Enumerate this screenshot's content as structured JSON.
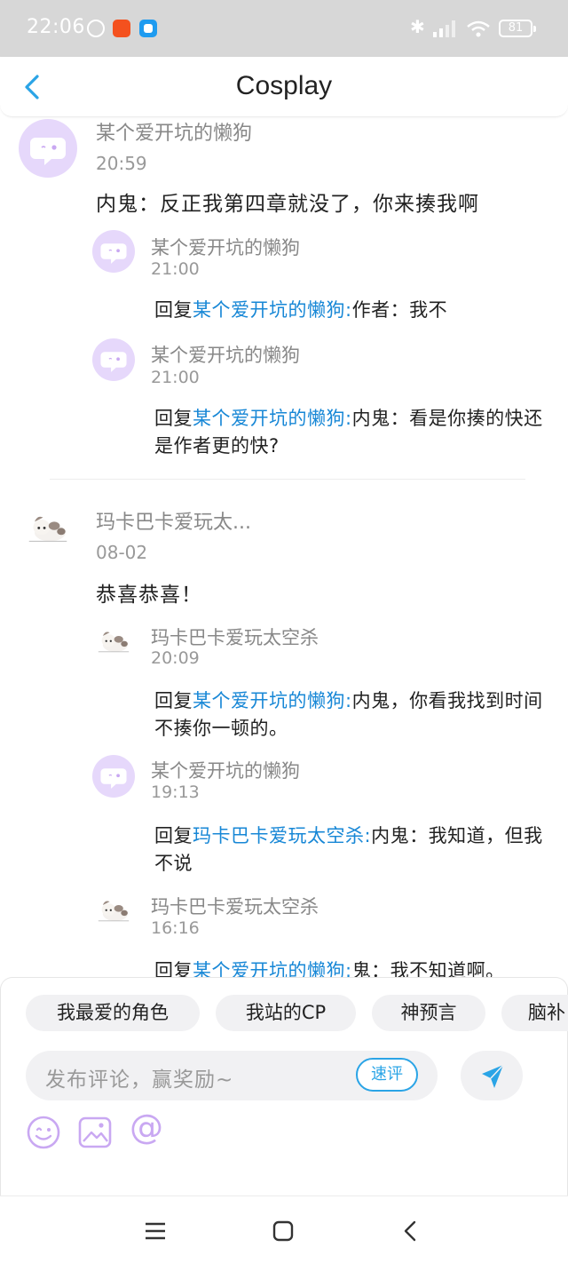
{
  "status_bar": {
    "time": "22:06",
    "battery": "81",
    "bluetooth_glyph": "✱"
  },
  "header": {
    "title": "Cosplay"
  },
  "comments": [
    {
      "author": "某个爱开坑的懒狗",
      "time": "20:59",
      "text": "内鬼：反正我第四章就没了，你来揍我啊",
      "avatar": "chat-bubble-avatar",
      "replies": [
        {
          "author": "某个爱开坑的懒狗",
          "time": "21:00",
          "prefix": "回复",
          "mention": "某个爱开坑的懒狗:",
          "text": "作者：我不"
        },
        {
          "author": "某个爱开坑的懒狗",
          "time": "21:00",
          "prefix": "回复",
          "mention": "某个爱开坑的懒狗:",
          "text": "内鬼：看是你揍的快还是作者更的快?"
        }
      ]
    },
    {
      "author": "玛卡巴卡爱玩太...",
      "time": "08-02",
      "text": "恭喜恭喜！",
      "avatar": "dog-avatar",
      "replies": [
        {
          "author": "玛卡巴卡爱玩太空杀",
          "time": "20:09",
          "prefix": "回复",
          "mention": "某个爱开坑的懒狗:",
          "text": "内鬼，你看我找到时间不揍你一顿的。"
        },
        {
          "author": "某个爱开坑的懒狗",
          "time": "19:13",
          "prefix": "回复",
          "mention": "玛卡巴卡爱玩太空杀:",
          "text": "内鬼：我知道，但我不说"
        },
        {
          "author": "玛卡巴卡爱玩太空杀",
          "time": "16:16",
          "prefix": "回复",
          "mention": "某个爱开坑的懒狗:",
          "text": "鬼：我不知道啊。"
        }
      ]
    }
  ],
  "quick_tags": [
    "我最爱的角色",
    "我站的CP",
    "神预言",
    "脑补"
  ],
  "composer": {
    "placeholder": "发布评论，赢奖励~",
    "quick_review_label": "速评",
    "tools": [
      "emoji-icon",
      "image-icon",
      "mention-icon"
    ],
    "mention_glyph": "@"
  },
  "colors": {
    "accent": "#2aa4e6",
    "mention": "#1787d6",
    "avatar_bg": "#e6d8fb",
    "icon_purple": "#c9a8f2"
  }
}
